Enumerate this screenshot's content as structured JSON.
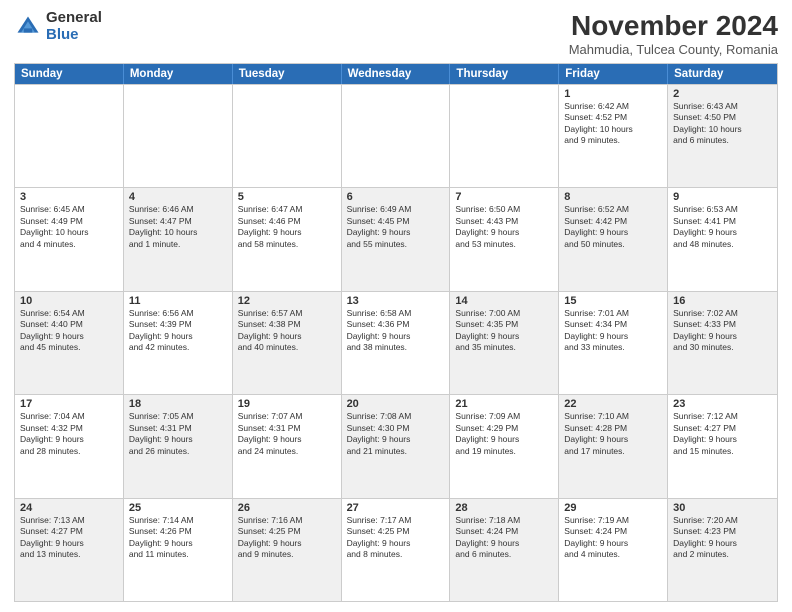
{
  "logo": {
    "general": "General",
    "blue": "Blue"
  },
  "title": "November 2024",
  "subtitle": "Mahmudia, Tulcea County, Romania",
  "headers": [
    "Sunday",
    "Monday",
    "Tuesday",
    "Wednesday",
    "Thursday",
    "Friday",
    "Saturday"
  ],
  "rows": [
    [
      {
        "day": "",
        "info": "",
        "empty": true
      },
      {
        "day": "",
        "info": "",
        "empty": true
      },
      {
        "day": "",
        "info": "",
        "empty": true
      },
      {
        "day": "",
        "info": "",
        "empty": true
      },
      {
        "day": "",
        "info": "",
        "empty": true
      },
      {
        "day": "1",
        "info": "Sunrise: 6:42 AM\nSunset: 4:52 PM\nDaylight: 10 hours\nand 9 minutes.",
        "empty": false
      },
      {
        "day": "2",
        "info": "Sunrise: 6:43 AM\nSunset: 4:50 PM\nDaylight: 10 hours\nand 6 minutes.",
        "empty": false,
        "shaded": true
      }
    ],
    [
      {
        "day": "3",
        "info": "Sunrise: 6:45 AM\nSunset: 4:49 PM\nDaylight: 10 hours\nand 4 minutes.",
        "empty": false
      },
      {
        "day": "4",
        "info": "Sunrise: 6:46 AM\nSunset: 4:47 PM\nDaylight: 10 hours\nand 1 minute.",
        "empty": false,
        "shaded": true
      },
      {
        "day": "5",
        "info": "Sunrise: 6:47 AM\nSunset: 4:46 PM\nDaylight: 9 hours\nand 58 minutes.",
        "empty": false
      },
      {
        "day": "6",
        "info": "Sunrise: 6:49 AM\nSunset: 4:45 PM\nDaylight: 9 hours\nand 55 minutes.",
        "empty": false,
        "shaded": true
      },
      {
        "day": "7",
        "info": "Sunrise: 6:50 AM\nSunset: 4:43 PM\nDaylight: 9 hours\nand 53 minutes.",
        "empty": false
      },
      {
        "day": "8",
        "info": "Sunrise: 6:52 AM\nSunset: 4:42 PM\nDaylight: 9 hours\nand 50 minutes.",
        "empty": false,
        "shaded": true
      },
      {
        "day": "9",
        "info": "Sunrise: 6:53 AM\nSunset: 4:41 PM\nDaylight: 9 hours\nand 48 minutes.",
        "empty": false
      }
    ],
    [
      {
        "day": "10",
        "info": "Sunrise: 6:54 AM\nSunset: 4:40 PM\nDaylight: 9 hours\nand 45 minutes.",
        "empty": false,
        "shaded": true
      },
      {
        "day": "11",
        "info": "Sunrise: 6:56 AM\nSunset: 4:39 PM\nDaylight: 9 hours\nand 42 minutes.",
        "empty": false
      },
      {
        "day": "12",
        "info": "Sunrise: 6:57 AM\nSunset: 4:38 PM\nDaylight: 9 hours\nand 40 minutes.",
        "empty": false,
        "shaded": true
      },
      {
        "day": "13",
        "info": "Sunrise: 6:58 AM\nSunset: 4:36 PM\nDaylight: 9 hours\nand 38 minutes.",
        "empty": false
      },
      {
        "day": "14",
        "info": "Sunrise: 7:00 AM\nSunset: 4:35 PM\nDaylight: 9 hours\nand 35 minutes.",
        "empty": false,
        "shaded": true
      },
      {
        "day": "15",
        "info": "Sunrise: 7:01 AM\nSunset: 4:34 PM\nDaylight: 9 hours\nand 33 minutes.",
        "empty": false
      },
      {
        "day": "16",
        "info": "Sunrise: 7:02 AM\nSunset: 4:33 PM\nDaylight: 9 hours\nand 30 minutes.",
        "empty": false,
        "shaded": true
      }
    ],
    [
      {
        "day": "17",
        "info": "Sunrise: 7:04 AM\nSunset: 4:32 PM\nDaylight: 9 hours\nand 28 minutes.",
        "empty": false
      },
      {
        "day": "18",
        "info": "Sunrise: 7:05 AM\nSunset: 4:31 PM\nDaylight: 9 hours\nand 26 minutes.",
        "empty": false,
        "shaded": true
      },
      {
        "day": "19",
        "info": "Sunrise: 7:07 AM\nSunset: 4:31 PM\nDaylight: 9 hours\nand 24 minutes.",
        "empty": false
      },
      {
        "day": "20",
        "info": "Sunrise: 7:08 AM\nSunset: 4:30 PM\nDaylight: 9 hours\nand 21 minutes.",
        "empty": false,
        "shaded": true
      },
      {
        "day": "21",
        "info": "Sunrise: 7:09 AM\nSunset: 4:29 PM\nDaylight: 9 hours\nand 19 minutes.",
        "empty": false
      },
      {
        "day": "22",
        "info": "Sunrise: 7:10 AM\nSunset: 4:28 PM\nDaylight: 9 hours\nand 17 minutes.",
        "empty": false,
        "shaded": true
      },
      {
        "day": "23",
        "info": "Sunrise: 7:12 AM\nSunset: 4:27 PM\nDaylight: 9 hours\nand 15 minutes.",
        "empty": false
      }
    ],
    [
      {
        "day": "24",
        "info": "Sunrise: 7:13 AM\nSunset: 4:27 PM\nDaylight: 9 hours\nand 13 minutes.",
        "empty": false,
        "shaded": true
      },
      {
        "day": "25",
        "info": "Sunrise: 7:14 AM\nSunset: 4:26 PM\nDaylight: 9 hours\nand 11 minutes.",
        "empty": false
      },
      {
        "day": "26",
        "info": "Sunrise: 7:16 AM\nSunset: 4:25 PM\nDaylight: 9 hours\nand 9 minutes.",
        "empty": false,
        "shaded": true
      },
      {
        "day": "27",
        "info": "Sunrise: 7:17 AM\nSunset: 4:25 PM\nDaylight: 9 hours\nand 8 minutes.",
        "empty": false
      },
      {
        "day": "28",
        "info": "Sunrise: 7:18 AM\nSunset: 4:24 PM\nDaylight: 9 hours\nand 6 minutes.",
        "empty": false,
        "shaded": true
      },
      {
        "day": "29",
        "info": "Sunrise: 7:19 AM\nSunset: 4:24 PM\nDaylight: 9 hours\nand 4 minutes.",
        "empty": false
      },
      {
        "day": "30",
        "info": "Sunrise: 7:20 AM\nSunset: 4:23 PM\nDaylight: 9 hours\nand 2 minutes.",
        "empty": false,
        "shaded": true
      }
    ]
  ]
}
